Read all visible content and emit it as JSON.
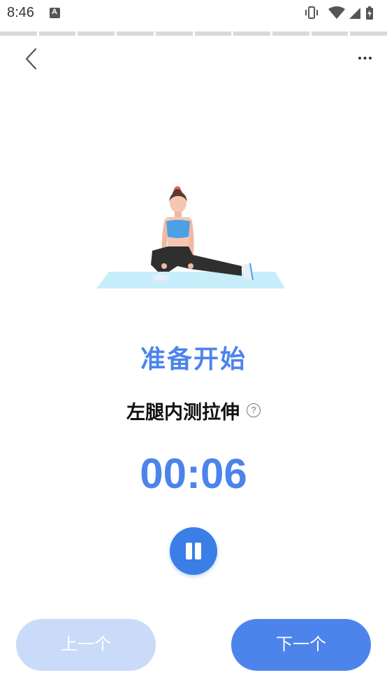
{
  "status_bar": {
    "time": "8:46",
    "notification_icon": "A"
  },
  "workout": {
    "progress_segments": 10,
    "title": "准备开始",
    "exercise_name": "左腿内测拉伸",
    "help_icon": "?",
    "timer": "00:06"
  },
  "nav": {
    "prev_label": "上一个",
    "next_label": "下一个"
  },
  "colors": {
    "accent": "#4c84ec",
    "pause_button": "#3a7ee6",
    "prev_disabled": "#c9dbf8",
    "mat": "#c9eefb"
  }
}
